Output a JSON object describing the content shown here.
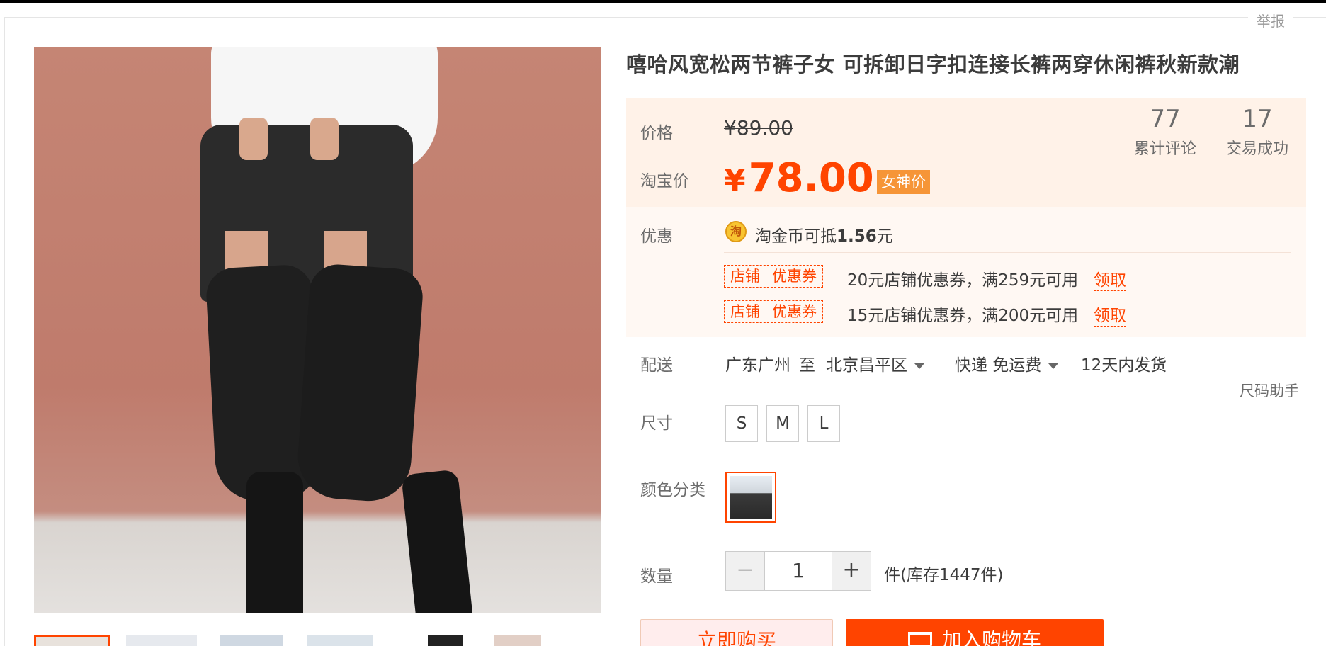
{
  "header": {
    "report_label": "举报"
  },
  "product": {
    "title": "嘻哈风宽松两节裤子女 可拆卸日字扣连接长裤两穿休闲裤秋新款潮"
  },
  "price": {
    "label": "价格",
    "original": "¥89.00",
    "taobao_label": "淘宝价",
    "currency": "¥",
    "current": "78.00",
    "tag": "女神价"
  },
  "stats": {
    "reviews_count": "77",
    "reviews_label": "累计评论",
    "deals_count": "17",
    "deals_label": "交易成功"
  },
  "promo": {
    "label": "优惠",
    "coin_icon_char": "淘",
    "coin_text": "淘金币可抵",
    "coin_amount": "1.56",
    "coin_unit": "元",
    "coupons": [
      {
        "tag1": "店铺",
        "tag2": "优惠券",
        "desc": "20元店铺优惠券，满259元可用",
        "claim": "领取"
      },
      {
        "tag1": "店铺",
        "tag2": "优惠券",
        "desc": "15元店铺优惠券，满200元可用",
        "claim": "领取"
      }
    ]
  },
  "shipping": {
    "label": "配送",
    "from": "广东广州",
    "to_word": "至",
    "destination": "北京昌平区",
    "method": "快递 免运费",
    "dispatch": "12天内发货"
  },
  "size_helper": "尺码助手",
  "size": {
    "label": "尺寸",
    "options": [
      "S",
      "M",
      "L"
    ]
  },
  "color": {
    "label": "颜色分类"
  },
  "quantity": {
    "label": "数量",
    "value": "1",
    "minus": "−",
    "plus": "+",
    "stock": "件(库存1447件)"
  },
  "actions": {
    "buy_now": "立即购买",
    "add_to_cart": "加入购物车"
  },
  "colors": {
    "accent": "#ff4400",
    "price_bg": "#fff2e8",
    "tag_bg": "#f69537"
  },
  "icons": [
    "coin-icon",
    "caret-down-icon",
    "cart-icon"
  ]
}
